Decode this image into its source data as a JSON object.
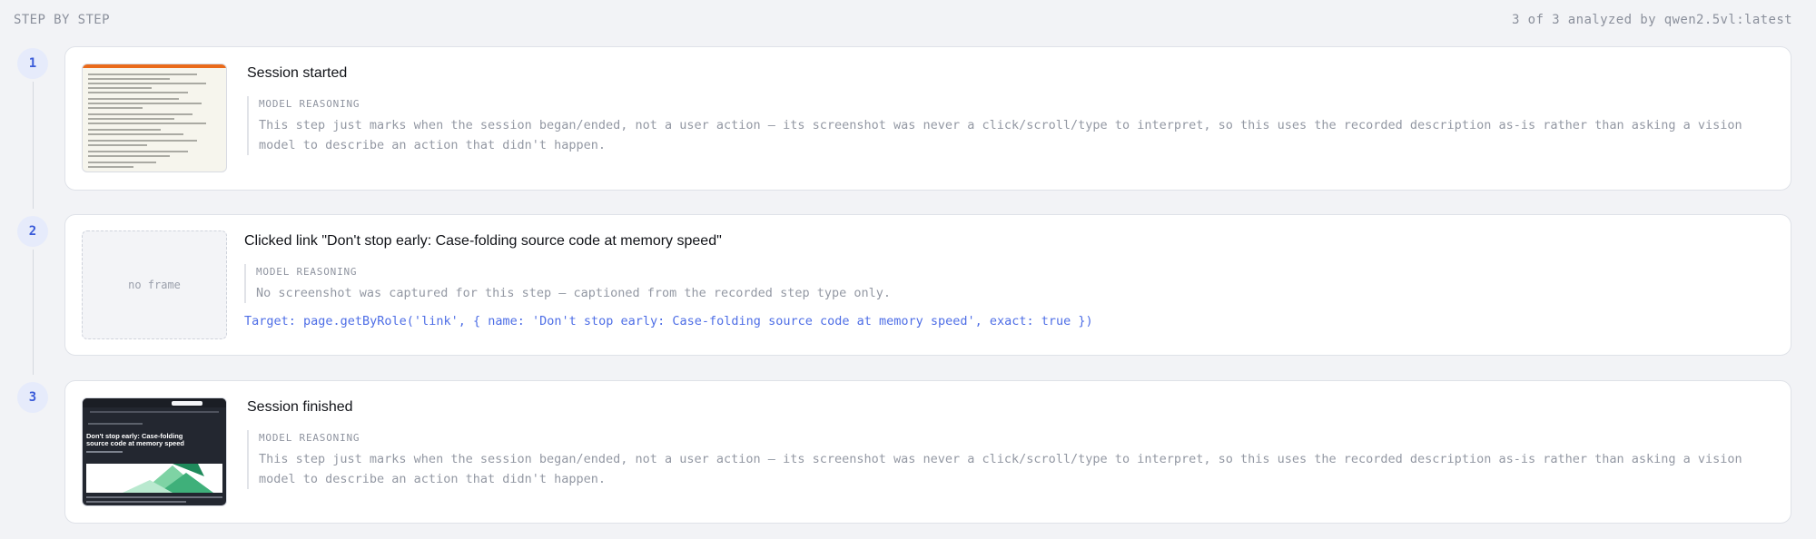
{
  "header": {
    "title": "STEP BY STEP",
    "status": "3 of 3 analyzed by qwen2.5vl:latest"
  },
  "steps": [
    {
      "number": "1",
      "title": "Session started",
      "reasoning_label": "MODEL REASONING",
      "reasoning": "This step just marks when the session began/ended, not a user action — its screenshot was never a click/scroll/type to interpret, so this uses the recorded description as-is rather than asking a vision model to describe an action that didn't happen.",
      "thumbnail": "document-screenshot"
    },
    {
      "number": "2",
      "title": "Clicked link \"Don't stop early: Case-folding source code at memory speed\"",
      "reasoning_label": "MODEL REASONING",
      "reasoning": "No screenshot was captured for this step — captioned from the recorded step type only.",
      "thumbnail_placeholder": "no frame",
      "target": "Target: page.getByRole('link', { name: 'Don't stop early: Case-folding source code at memory speed', exact: true })"
    },
    {
      "number": "3",
      "title": "Session finished",
      "reasoning_label": "MODEL REASONING",
      "reasoning": "This step just marks when the session began/ended, not a user action — its screenshot was never a click/scroll/type to interpret, so this uses the recorded description as-is rather than asking a vision model to describe an action that didn't happen.",
      "thumbnail": "article-screenshot",
      "thumbnail_headline": "Don't stop early: Case-folding source code at memory speed"
    }
  ],
  "colors": {
    "background": "#f2f3f6",
    "accent": "#3a5bd9",
    "target_text": "#4e6ee6",
    "thumb_bar": "#ea6a1a"
  }
}
